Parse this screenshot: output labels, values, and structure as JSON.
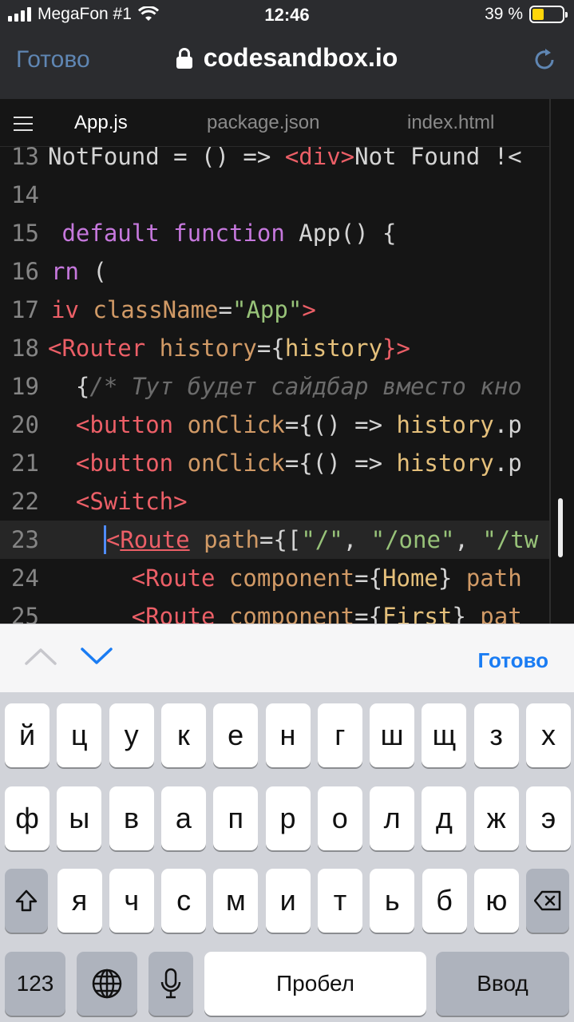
{
  "status_bar": {
    "carrier": "MegaFon #1",
    "time": "12:46",
    "battery_percent": "39 %",
    "battery_level": 0.39
  },
  "safari": {
    "done_label": "Готово",
    "url": "codesandbox.io"
  },
  "editor": {
    "tabs": [
      {
        "label": "App.js",
        "active": true
      },
      {
        "label": "package.json",
        "active": false
      },
      {
        "label": "index.html",
        "active": false
      }
    ],
    "line_numbers": [
      "13",
      "14",
      "15",
      "16",
      "17",
      "18",
      "19",
      "20",
      "21",
      "22",
      "23",
      "24",
      "25"
    ],
    "lines": {
      "l13": {
        "a": "NotFound = () => ",
        "b": "<div>",
        "c": "Not Found !<"
      },
      "l15": {
        "a": " default",
        "b": " function",
        "c": " App() {"
      },
      "l16": {
        "a": "rn",
        "b": " ("
      },
      "l17": {
        "a": "iv",
        "b": " className",
        "c": "=",
        "d": "\"App\"",
        "e": ">"
      },
      "l18": {
        "a": "<Router",
        "b": " history",
        "c": "={",
        "d": "history",
        "e": "}>"
      },
      "l19": {
        "a": "  {",
        "b": "/* Тут будет сайдбар вместо кно"
      },
      "l20": {
        "a": "  <button",
        "b": " onClick",
        "c": "={() => ",
        "d": "history",
        "e": ".p"
      },
      "l21": {
        "a": "  <button",
        "b": " onClick",
        "c": "={() => ",
        "d": "history",
        "e": ".p"
      },
      "l22": {
        "a": "  <Switch>"
      },
      "l23": {
        "a": "    ",
        "b": "<",
        "c": "Route",
        "d": " path",
        "e": "={[",
        "f": "\"/\"",
        "g": ", ",
        "h": "\"/one\"",
        "i": ", ",
        "j": "\"/tw"
      },
      "l24": {
        "a": "      <Route",
        "b": " component",
        "c": "={",
        "d": "Home",
        "e": "}",
        "f": " path"
      },
      "l25": {
        "a": "      <Route",
        "b": " component",
        "c": "={",
        "d": "First",
        "e": "}",
        "f": " pat"
      }
    }
  },
  "keyboard_accessory": {
    "done_label": "Готово"
  },
  "keyboard": {
    "row1": [
      "й",
      "ц",
      "у",
      "к",
      "е",
      "н",
      "г",
      "ш",
      "щ",
      "з",
      "х"
    ],
    "row2": [
      "ф",
      "ы",
      "в",
      "а",
      "п",
      "р",
      "о",
      "л",
      "д",
      "ж",
      "э"
    ],
    "row3": [
      "я",
      "ч",
      "с",
      "м",
      "и",
      "т",
      "ь",
      "б",
      "ю"
    ],
    "numbers_label": "123",
    "space_label": "Пробел",
    "return_label": "Ввод",
    "icons": {
      "shift": "shift-icon",
      "backspace": "backspace-icon",
      "globe": "globe-icon",
      "mic": "microphone-icon"
    }
  }
}
